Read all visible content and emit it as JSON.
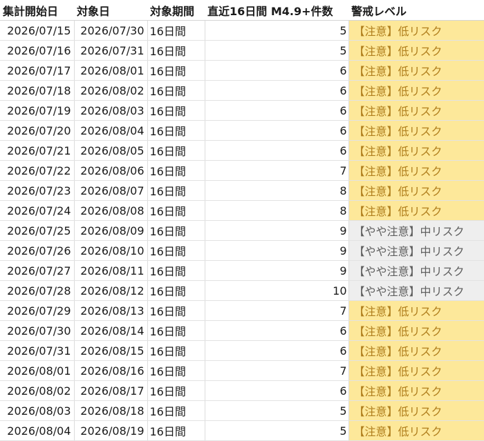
{
  "headers": [
    "集計開始日",
    "対象日",
    "対象期間",
    "直近16日間 M4.9+件数",
    "警戒レベル"
  ],
  "levels": {
    "low": "【注意】低リスク",
    "mid": "【やや注意】中リスク"
  },
  "colors": {
    "low_bg": "#fde89a",
    "low_text": "#b07e1c",
    "mid_bg": "#eeeeee",
    "mid_text": "#5e5e5e"
  },
  "rows": [
    {
      "start": "2026/07/15",
      "target": "2026/07/30",
      "period": "16日間",
      "count": "5",
      "level": "【注意】低リスク",
      "tier": "low"
    },
    {
      "start": "2026/07/16",
      "target": "2026/07/31",
      "period": "16日間",
      "count": "5",
      "level": "【注意】低リスク",
      "tier": "low"
    },
    {
      "start": "2026/07/17",
      "target": "2026/08/01",
      "period": "16日間",
      "count": "6",
      "level": "【注意】低リスク",
      "tier": "low"
    },
    {
      "start": "2026/07/18",
      "target": "2026/08/02",
      "period": "16日間",
      "count": "6",
      "level": "【注意】低リスク",
      "tier": "low"
    },
    {
      "start": "2026/07/19",
      "target": "2026/08/03",
      "period": "16日間",
      "count": "6",
      "level": "【注意】低リスク",
      "tier": "low"
    },
    {
      "start": "2026/07/20",
      "target": "2026/08/04",
      "period": "16日間",
      "count": "6",
      "level": "【注意】低リスク",
      "tier": "low"
    },
    {
      "start": "2026/07/21",
      "target": "2026/08/05",
      "period": "16日間",
      "count": "6",
      "level": "【注意】低リスク",
      "tier": "low"
    },
    {
      "start": "2026/07/22",
      "target": "2026/08/06",
      "period": "16日間",
      "count": "7",
      "level": "【注意】低リスク",
      "tier": "low"
    },
    {
      "start": "2026/07/23",
      "target": "2026/08/07",
      "period": "16日間",
      "count": "8",
      "level": "【注意】低リスク",
      "tier": "low"
    },
    {
      "start": "2026/07/24",
      "target": "2026/08/08",
      "period": "16日間",
      "count": "8",
      "level": "【注意】低リスク",
      "tier": "low"
    },
    {
      "start": "2026/07/25",
      "target": "2026/08/09",
      "period": "16日間",
      "count": "9",
      "level": "【やや注意】中リスク",
      "tier": "mid"
    },
    {
      "start": "2026/07/26",
      "target": "2026/08/10",
      "period": "16日間",
      "count": "9",
      "level": "【やや注意】中リスク",
      "tier": "mid"
    },
    {
      "start": "2026/07/27",
      "target": "2026/08/11",
      "period": "16日間",
      "count": "9",
      "level": "【やや注意】中リスク",
      "tier": "mid"
    },
    {
      "start": "2026/07/28",
      "target": "2026/08/12",
      "period": "16日間",
      "count": "10",
      "level": "【やや注意】中リスク",
      "tier": "mid"
    },
    {
      "start": "2026/07/29",
      "target": "2026/08/13",
      "period": "16日間",
      "count": "7",
      "level": "【注意】低リスク",
      "tier": "low"
    },
    {
      "start": "2026/07/30",
      "target": "2026/08/14",
      "period": "16日間",
      "count": "6",
      "level": "【注意】低リスク",
      "tier": "low"
    },
    {
      "start": "2026/07/31",
      "target": "2026/08/15",
      "period": "16日間",
      "count": "6",
      "level": "【注意】低リスク",
      "tier": "low"
    },
    {
      "start": "2026/08/01",
      "target": "2026/08/16",
      "period": "16日間",
      "count": "7",
      "level": "【注意】低リスク",
      "tier": "low"
    },
    {
      "start": "2026/08/02",
      "target": "2026/08/17",
      "period": "16日間",
      "count": "6",
      "level": "【注意】低リスク",
      "tier": "low"
    },
    {
      "start": "2026/08/03",
      "target": "2026/08/18",
      "period": "16日間",
      "count": "5",
      "level": "【注意】低リスク",
      "tier": "low"
    },
    {
      "start": "2026/08/04",
      "target": "2026/08/19",
      "period": "16日間",
      "count": "5",
      "level": "【注意】低リスク",
      "tier": "low"
    }
  ]
}
